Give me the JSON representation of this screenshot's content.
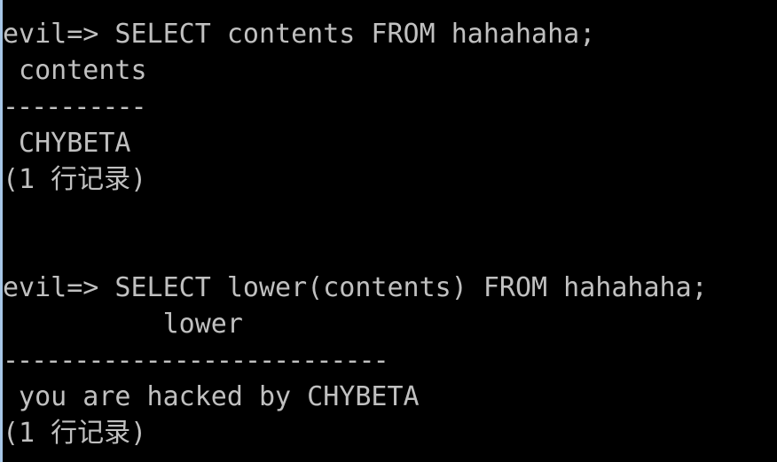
{
  "terminal": {
    "lines": [
      "evil=> SELECT contents FROM hahahaha;",
      " contents",
      "----------",
      " CHYBETA",
      "(1 行记录)",
      "",
      "",
      "evil=> SELECT lower(contents) FROM hahahaha;",
      "          lower",
      "---------------------------",
      " you are hacked by CHYBETA",
      "(1 行记录)"
    ]
  },
  "colors": {
    "background": "#000000",
    "foreground": "#c0c0c0"
  }
}
